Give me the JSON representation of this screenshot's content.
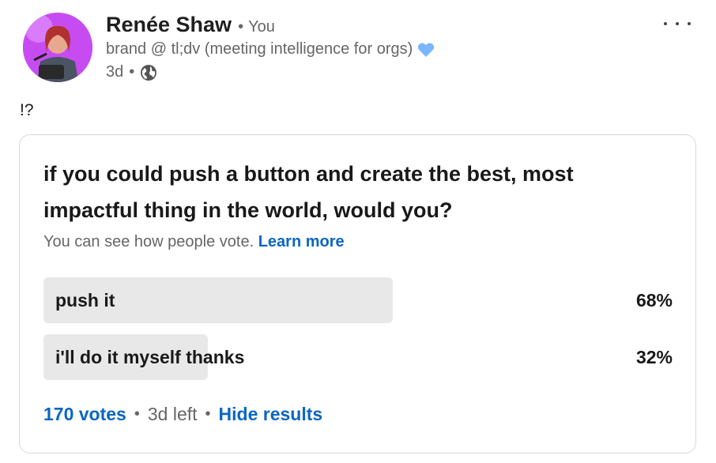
{
  "post": {
    "author": {
      "name": "Renée Shaw",
      "relation": "You",
      "headline": "brand @ tl;dv (meeting intelligence for orgs)"
    },
    "age": "3d",
    "visibility_icon": "globe-icon",
    "text": "!?",
    "menu_icon": "more-horizontal-icon"
  },
  "poll": {
    "question": "if you could push a button and create the best, most impactful thing in the world, would you?",
    "note": "You can see how people vote.",
    "learn_more": "Learn more",
    "options": [
      {
        "label": "push it",
        "percent_label": "68%",
        "fraction": 0.68
      },
      {
        "label": "i'll do it myself thanks",
        "percent_label": "32%",
        "fraction": 0.32
      }
    ],
    "votes": "170 votes",
    "time_left": "3d left",
    "hide_results": "Hide results"
  },
  "colors": {
    "link": "#0a66c2",
    "bar": "#e8e8e8",
    "muted": "#666666",
    "heart": "#7ab6ff"
  }
}
